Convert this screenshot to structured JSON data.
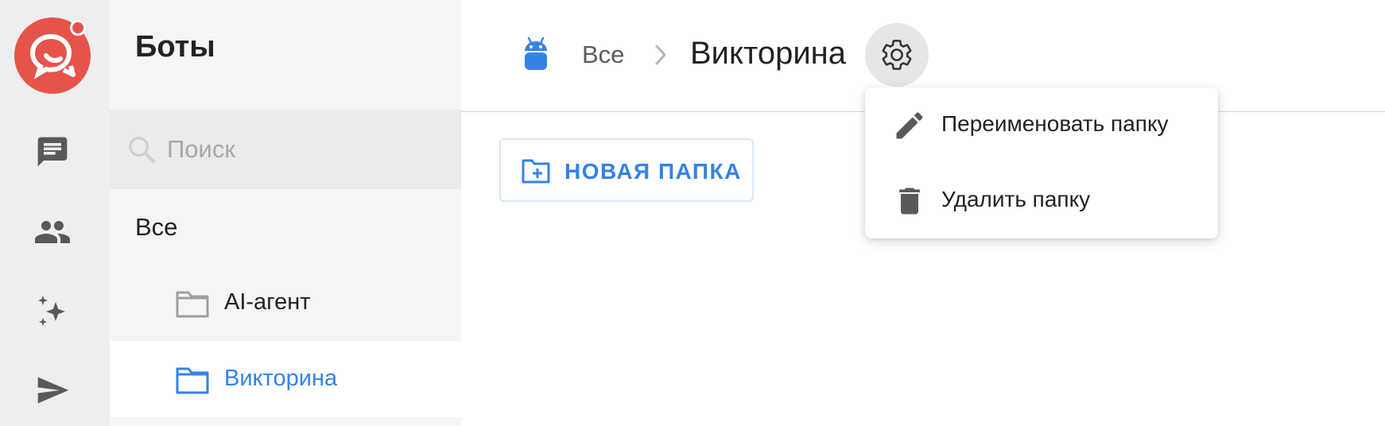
{
  "app": {
    "logo_icon": "chat-logo",
    "accent": "#3582e6",
    "brand": "#e5534b"
  },
  "rail": {
    "items": [
      {
        "icon": "chat-icon"
      },
      {
        "icon": "contacts-icon"
      },
      {
        "icon": "ai-sparkle-icon"
      },
      {
        "icon": "send-icon"
      }
    ]
  },
  "sidebar": {
    "title": "Боты",
    "search_placeholder": "Поиск",
    "all_label": "Все",
    "folders": [
      {
        "label": "AI-агент",
        "active": false
      },
      {
        "label": "Викторина",
        "active": true
      }
    ]
  },
  "header": {
    "breadcrumb_root": "Все",
    "breadcrumb_current": "Викторина"
  },
  "toolbar": {
    "new_folder_label": "НОВАЯ ПАПКА"
  },
  "folder_menu": {
    "rename_label": "Переименовать папку",
    "delete_label": "Удалить папку"
  }
}
